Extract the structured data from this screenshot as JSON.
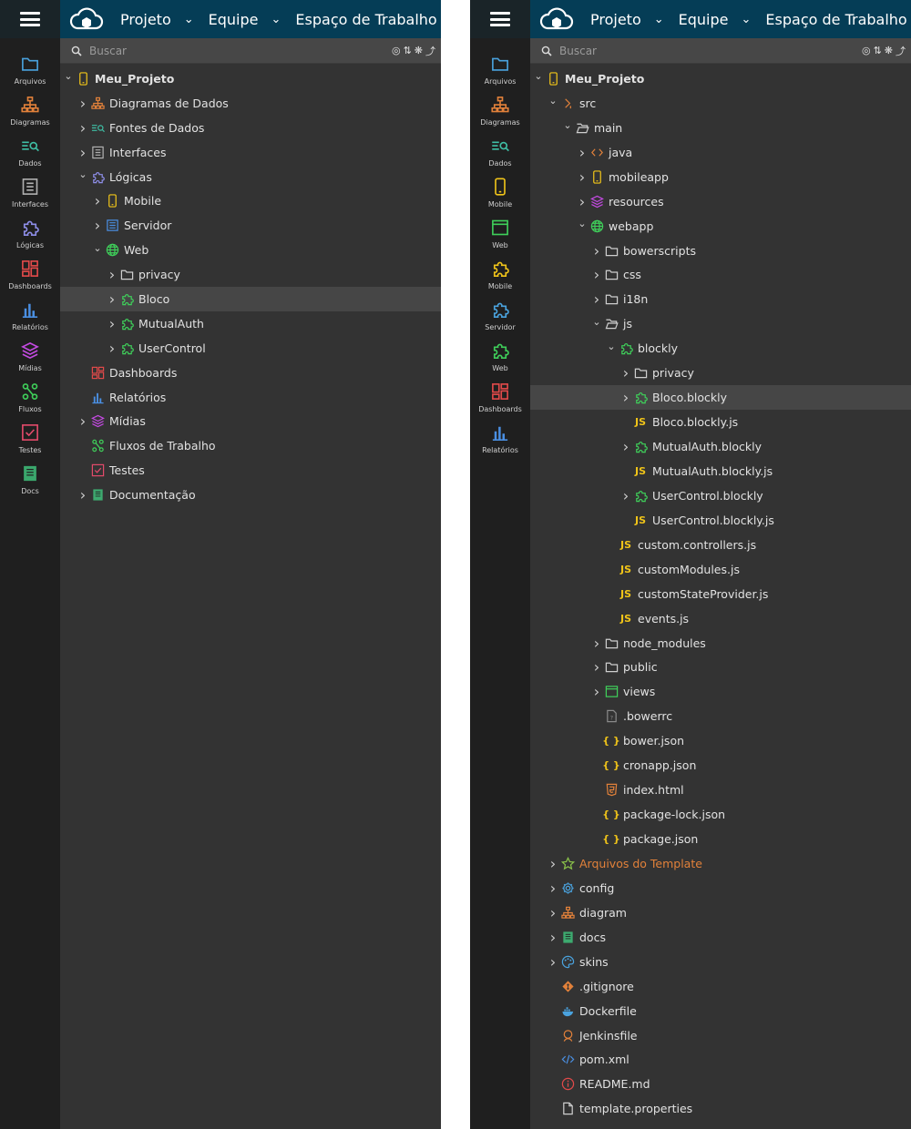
{
  "topbar": {
    "menu": [
      {
        "label": "Projeto"
      },
      {
        "label": "Equipe"
      },
      {
        "label": "Espaço de Trabalho"
      }
    ]
  },
  "search": {
    "placeholder": "Buscar"
  },
  "colors": {
    "topbar": "#053d56",
    "panel": "#333333",
    "iconbar": "#1f1f1f",
    "selection": "#464646",
    "accent_orange": "#e2813a",
    "js_yellow": "#f0c419"
  },
  "left": {
    "sidebar": [
      {
        "label": "Arquivos",
        "icon": "folder-icon",
        "color": "#4aa3df"
      },
      {
        "label": "Diagramas",
        "icon": "hierarchy-icon",
        "color": "#e2813a"
      },
      {
        "label": "Dados",
        "icon": "data-search-icon",
        "color": "#3fbfa5"
      },
      {
        "label": "Interfaces",
        "icon": "list-window-icon",
        "color": "#b0b0b0"
      },
      {
        "label": "Lógicas",
        "icon": "puzzle-icon",
        "color": "#8e8ee8"
      },
      {
        "label": "Dashboards",
        "icon": "dashboard-icon",
        "color": "#e24a4a"
      },
      {
        "label": "Relatórios",
        "icon": "bar-chart-icon",
        "color": "#4a8fe2"
      },
      {
        "label": "Mídias",
        "icon": "layers-icon",
        "color": "#c44ae2"
      },
      {
        "label": "Fluxos",
        "icon": "flow-icon",
        "color": "#3fcf5a"
      },
      {
        "label": "Testes",
        "icon": "check-box-icon",
        "color": "#e24a6a"
      },
      {
        "label": "Docs",
        "icon": "book-icon",
        "color": "#3fbf7a"
      }
    ],
    "tree": [
      {
        "label": "Meu_Projeto",
        "level": 0,
        "toggle": "open",
        "icon": "mobile-icon",
        "color": "#f0c419",
        "bold": true
      },
      {
        "label": "Diagramas de Dados",
        "level": 1,
        "toggle": "closed",
        "icon": "hierarchy-icon",
        "color": "#e2813a"
      },
      {
        "label": "Fontes de Dados",
        "level": 1,
        "toggle": "closed",
        "icon": "data-search-icon",
        "color": "#3fbfa5"
      },
      {
        "label": "Interfaces",
        "level": 1,
        "toggle": "closed",
        "icon": "list-window-icon",
        "color": "#b0b0b0"
      },
      {
        "label": "Lógicas",
        "level": 1,
        "toggle": "open",
        "icon": "puzzle-icon",
        "color": "#8e8ee8"
      },
      {
        "label": "Mobile",
        "level": 2,
        "toggle": "closed",
        "icon": "mobile-icon",
        "color": "#f0c419"
      },
      {
        "label": "Servidor",
        "level": 2,
        "toggle": "closed",
        "icon": "server-icon",
        "color": "#4a8fe2"
      },
      {
        "label": "Web",
        "level": 2,
        "toggle": "open",
        "icon": "globe-icon",
        "color": "#3fcf5a"
      },
      {
        "label": "privacy",
        "level": 3,
        "toggle": "closed",
        "icon": "folder-icon",
        "color": "#cfcfcf"
      },
      {
        "label": "Bloco",
        "level": 3,
        "toggle": "closed",
        "icon": "puzzle-icon",
        "color": "#3fcf5a",
        "selected": true
      },
      {
        "label": "MutualAuth",
        "level": 3,
        "toggle": "closed",
        "icon": "puzzle-icon",
        "color": "#3fcf5a"
      },
      {
        "label": "UserControl",
        "level": 3,
        "toggle": "closed",
        "icon": "puzzle-icon",
        "color": "#3fcf5a"
      },
      {
        "label": "Dashboards",
        "level": 1,
        "toggle": "none",
        "icon": "dashboard-icon",
        "color": "#e24a4a"
      },
      {
        "label": "Relatórios",
        "level": 1,
        "toggle": "none",
        "icon": "bar-chart-icon",
        "color": "#4a8fe2"
      },
      {
        "label": "Mídias",
        "level": 1,
        "toggle": "closed",
        "icon": "layers-icon",
        "color": "#c44ae2"
      },
      {
        "label": "Fluxos de Trabalho",
        "level": 1,
        "toggle": "none",
        "icon": "flow-icon",
        "color": "#3fcf5a"
      },
      {
        "label": "Testes",
        "level": 1,
        "toggle": "none",
        "icon": "check-box-icon",
        "color": "#e24a6a"
      },
      {
        "label": "Documentação",
        "level": 1,
        "toggle": "closed",
        "icon": "book-icon",
        "color": "#3fbf7a"
      }
    ]
  },
  "right": {
    "sidebar": [
      {
        "label": "Arquivos",
        "icon": "folder-icon",
        "color": "#4aa3df"
      },
      {
        "label": "Diagramas",
        "icon": "hierarchy-icon",
        "color": "#e2813a"
      },
      {
        "label": "Dados",
        "icon": "data-search-icon",
        "color": "#3fbfa5"
      },
      {
        "label": "Mobile",
        "icon": "mobile-icon",
        "color": "#f0c419"
      },
      {
        "label": "Web",
        "icon": "browser-window-icon",
        "color": "#3fcf5a"
      },
      {
        "label": "Mobile",
        "icon": "puzzle-icon",
        "color": "#f0c419"
      },
      {
        "label": "Servidor",
        "icon": "puzzle-icon",
        "color": "#4aa3df"
      },
      {
        "label": "Web",
        "icon": "puzzle-icon",
        "color": "#3fcf5a"
      },
      {
        "label": "Dashboards",
        "icon": "dashboard-icon",
        "color": "#e24a4a"
      },
      {
        "label": "Relatórios",
        "icon": "bar-chart-icon",
        "color": "#4a8fe2"
      }
    ],
    "tree": [
      {
        "label": "Meu_Projeto",
        "level": 0,
        "toggle": "open",
        "icon": "mobile-icon",
        "color": "#f0c419",
        "bold": true
      },
      {
        "label": "src",
        "level": 1,
        "toggle": "open",
        "icon": "code-bracket-icon",
        "color": "#e2813a"
      },
      {
        "label": "main",
        "level": 2,
        "toggle": "open",
        "icon": "folder-open-icon",
        "color": "#cfcfcf"
      },
      {
        "label": "java",
        "level": 3,
        "toggle": "closed",
        "icon": "code-icon",
        "color": "#e2813a"
      },
      {
        "label": "mobileapp",
        "level": 3,
        "toggle": "closed",
        "icon": "mobile-icon",
        "color": "#f0c419"
      },
      {
        "label": "resources",
        "level": 3,
        "toggle": "closed",
        "icon": "layers-icon",
        "color": "#c44ae2"
      },
      {
        "label": "webapp",
        "level": 3,
        "toggle": "open",
        "icon": "globe-icon",
        "color": "#3fcf5a"
      },
      {
        "label": "bowerscripts",
        "level": 4,
        "toggle": "closed",
        "icon": "folder-icon",
        "color": "#cfcfcf"
      },
      {
        "label": "css",
        "level": 4,
        "toggle": "closed",
        "icon": "folder-icon",
        "color": "#cfcfcf"
      },
      {
        "label": "i18n",
        "level": 4,
        "toggle": "closed",
        "icon": "folder-icon",
        "color": "#cfcfcf"
      },
      {
        "label": "js",
        "level": 4,
        "toggle": "open",
        "icon": "folder-open-icon",
        "color": "#cfcfcf"
      },
      {
        "label": "blockly",
        "level": 5,
        "toggle": "open",
        "icon": "puzzle-icon",
        "color": "#3fcf5a"
      },
      {
        "label": "privacy",
        "level": 6,
        "toggle": "closed",
        "icon": "folder-icon",
        "color": "#cfcfcf"
      },
      {
        "label": "Bloco.blockly",
        "level": 6,
        "toggle": "closed",
        "icon": "puzzle-icon",
        "color": "#3fcf5a",
        "selected": true
      },
      {
        "label": "Bloco.blockly.js",
        "level": 6,
        "toggle": "none",
        "icon": "js-icon",
        "color": "#f0c419"
      },
      {
        "label": "MutualAuth.blockly",
        "level": 6,
        "toggle": "closed",
        "icon": "puzzle-icon",
        "color": "#3fcf5a"
      },
      {
        "label": "MutualAuth.blockly.js",
        "level": 6,
        "toggle": "none",
        "icon": "js-icon",
        "color": "#f0c419"
      },
      {
        "label": "UserControl.blockly",
        "level": 6,
        "toggle": "closed",
        "icon": "puzzle-icon",
        "color": "#3fcf5a"
      },
      {
        "label": "UserControl.blockly.js",
        "level": 6,
        "toggle": "none",
        "icon": "js-icon",
        "color": "#f0c419"
      },
      {
        "label": "custom.controllers.js",
        "level": 5,
        "toggle": "none",
        "icon": "js-icon",
        "color": "#f0c419"
      },
      {
        "label": "customModules.js",
        "level": 5,
        "toggle": "none",
        "icon": "js-icon",
        "color": "#f0c419"
      },
      {
        "label": "customStateProvider.js",
        "level": 5,
        "toggle": "none",
        "icon": "js-icon",
        "color": "#f0c419"
      },
      {
        "label": "events.js",
        "level": 5,
        "toggle": "none",
        "icon": "js-icon",
        "color": "#f0c419"
      },
      {
        "label": "node_modules",
        "level": 4,
        "toggle": "closed",
        "icon": "folder-icon",
        "color": "#cfcfcf"
      },
      {
        "label": "public",
        "level": 4,
        "toggle": "closed",
        "icon": "folder-icon",
        "color": "#cfcfcf"
      },
      {
        "label": "views",
        "level": 4,
        "toggle": "closed",
        "icon": "browser-window-icon",
        "color": "#3fcf5a"
      },
      {
        "label": ".bowerrc",
        "level": 4,
        "toggle": "none",
        "icon": "unknown-file-icon",
        "color": "#8a8a8a"
      },
      {
        "label": "bower.json",
        "level": 4,
        "toggle": "none",
        "icon": "json-icon",
        "color": "#f0c419"
      },
      {
        "label": "cronapp.json",
        "level": 4,
        "toggle": "none",
        "icon": "json-icon",
        "color": "#f0c419"
      },
      {
        "label": "index.html",
        "level": 4,
        "toggle": "none",
        "icon": "html5-icon",
        "color": "#e2813a"
      },
      {
        "label": "package-lock.json",
        "level": 4,
        "toggle": "none",
        "icon": "json-icon",
        "color": "#f0c419"
      },
      {
        "label": "package.json",
        "level": 4,
        "toggle": "none",
        "icon": "json-icon",
        "color": "#f0c419"
      },
      {
        "label": "Arquivos do Template",
        "level": 1,
        "toggle": "closed",
        "icon": "star-icon",
        "color": "#8bc34a",
        "orange": true
      },
      {
        "label": "config",
        "level": 1,
        "toggle": "closed",
        "icon": "gear-icon",
        "color": "#4aa3df"
      },
      {
        "label": "diagram",
        "level": 1,
        "toggle": "closed",
        "icon": "hierarchy-icon",
        "color": "#e2813a"
      },
      {
        "label": "docs",
        "level": 1,
        "toggle": "closed",
        "icon": "book-icon",
        "color": "#3fbf7a"
      },
      {
        "label": "skins",
        "level": 1,
        "toggle": "closed",
        "icon": "palette-icon",
        "color": "#4aa3df"
      },
      {
        "label": ".gitignore",
        "level": 1,
        "toggle": "none",
        "icon": "git-icon",
        "color": "#e2813a"
      },
      {
        "label": "Dockerfile",
        "level": 1,
        "toggle": "none",
        "icon": "docker-icon",
        "color": "#4aa3df"
      },
      {
        "label": "Jenkinsfile",
        "level": 1,
        "toggle": "none",
        "icon": "jenkins-icon",
        "color": "#e2813a"
      },
      {
        "label": "pom.xml",
        "level": 1,
        "toggle": "none",
        "icon": "xml-icon",
        "color": "#4a8fe2"
      },
      {
        "label": "README.md",
        "level": 1,
        "toggle": "none",
        "icon": "info-icon",
        "color": "#e24a4a"
      },
      {
        "label": "template.properties",
        "level": 1,
        "toggle": "none",
        "icon": "file-icon",
        "color": "#cfcfcf"
      }
    ]
  }
}
